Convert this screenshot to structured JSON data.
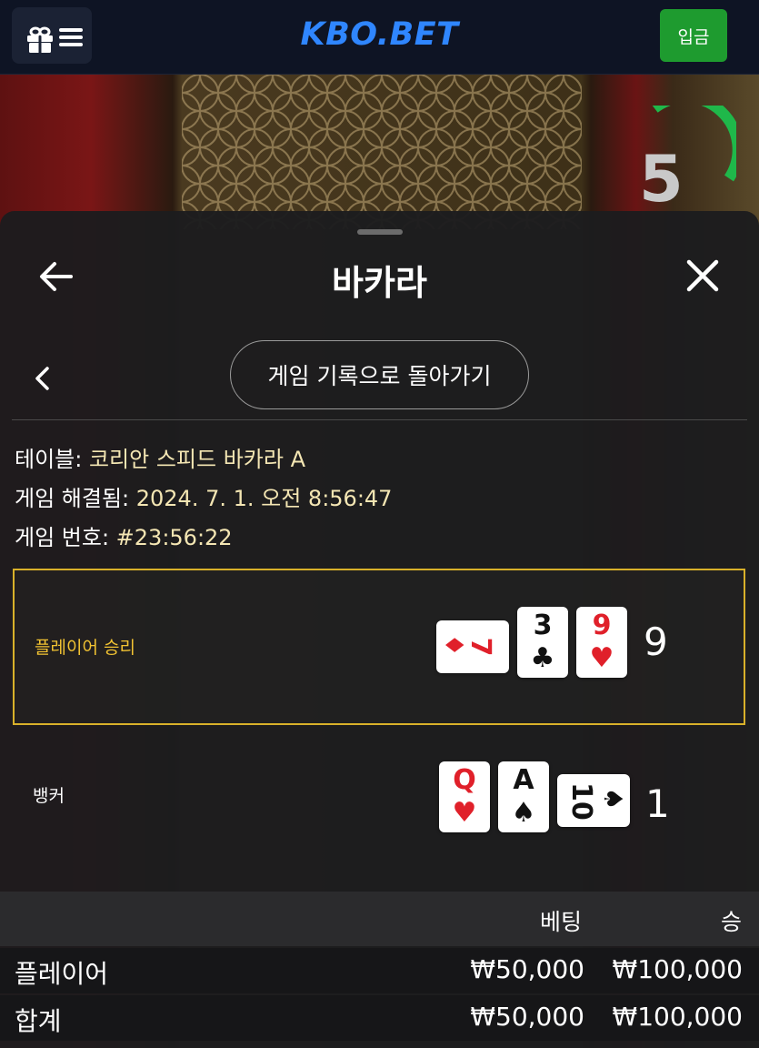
{
  "header": {
    "logo": "KBO.BET",
    "deposit_label": "입금",
    "icons": [
      "gift-icon",
      "hamburger-icon"
    ]
  },
  "video": {
    "timer": "5",
    "colors": {
      "timer_ring": "#1fb84a"
    }
  },
  "panel": {
    "title": "바카라",
    "history_button": "게임 기록으로 돌아가기",
    "info": {
      "table_label": "테이블: ",
      "table_value": "코리안 스피드 바카라 A",
      "resolved_label": "게임 해결됨: ",
      "resolved_value": "2024. 7. 1. 오전 8:56:47",
      "game_no_label": "게임 번호: ",
      "game_no_value": "#23:56:22"
    }
  },
  "results": {
    "player": {
      "label": "플레이어 승리",
      "score": "9",
      "cards": [
        {
          "rank": "7",
          "suit": "♦",
          "color": "red",
          "rotated": true
        },
        {
          "rank": "3",
          "suit": "♣",
          "color": "black",
          "rotated": false
        },
        {
          "rank": "9",
          "suit": "♥",
          "color": "red",
          "rotated": false
        }
      ]
    },
    "banker": {
      "label": "뱅커",
      "score": "1",
      "cards": [
        {
          "rank": "Q",
          "suit": "♥",
          "color": "red",
          "rotated": false
        },
        {
          "rank": "A",
          "suit": "♠",
          "color": "black",
          "rotated": false
        },
        {
          "rank": "10",
          "suit": "♠",
          "color": "black",
          "rotated": true
        }
      ]
    }
  },
  "bets": {
    "headers": {
      "bet": "베팅",
      "win": "승"
    },
    "rows": [
      {
        "label": "플레이어",
        "bet": "₩50,000",
        "win": "₩100,000"
      },
      {
        "label": "합계",
        "bet": "₩50,000",
        "win": "₩100,000"
      }
    ]
  },
  "colors": {
    "accent_gold": "#f1c232",
    "deposit_green": "#1e9b2f",
    "logo_blue": "#2f86ff"
  }
}
